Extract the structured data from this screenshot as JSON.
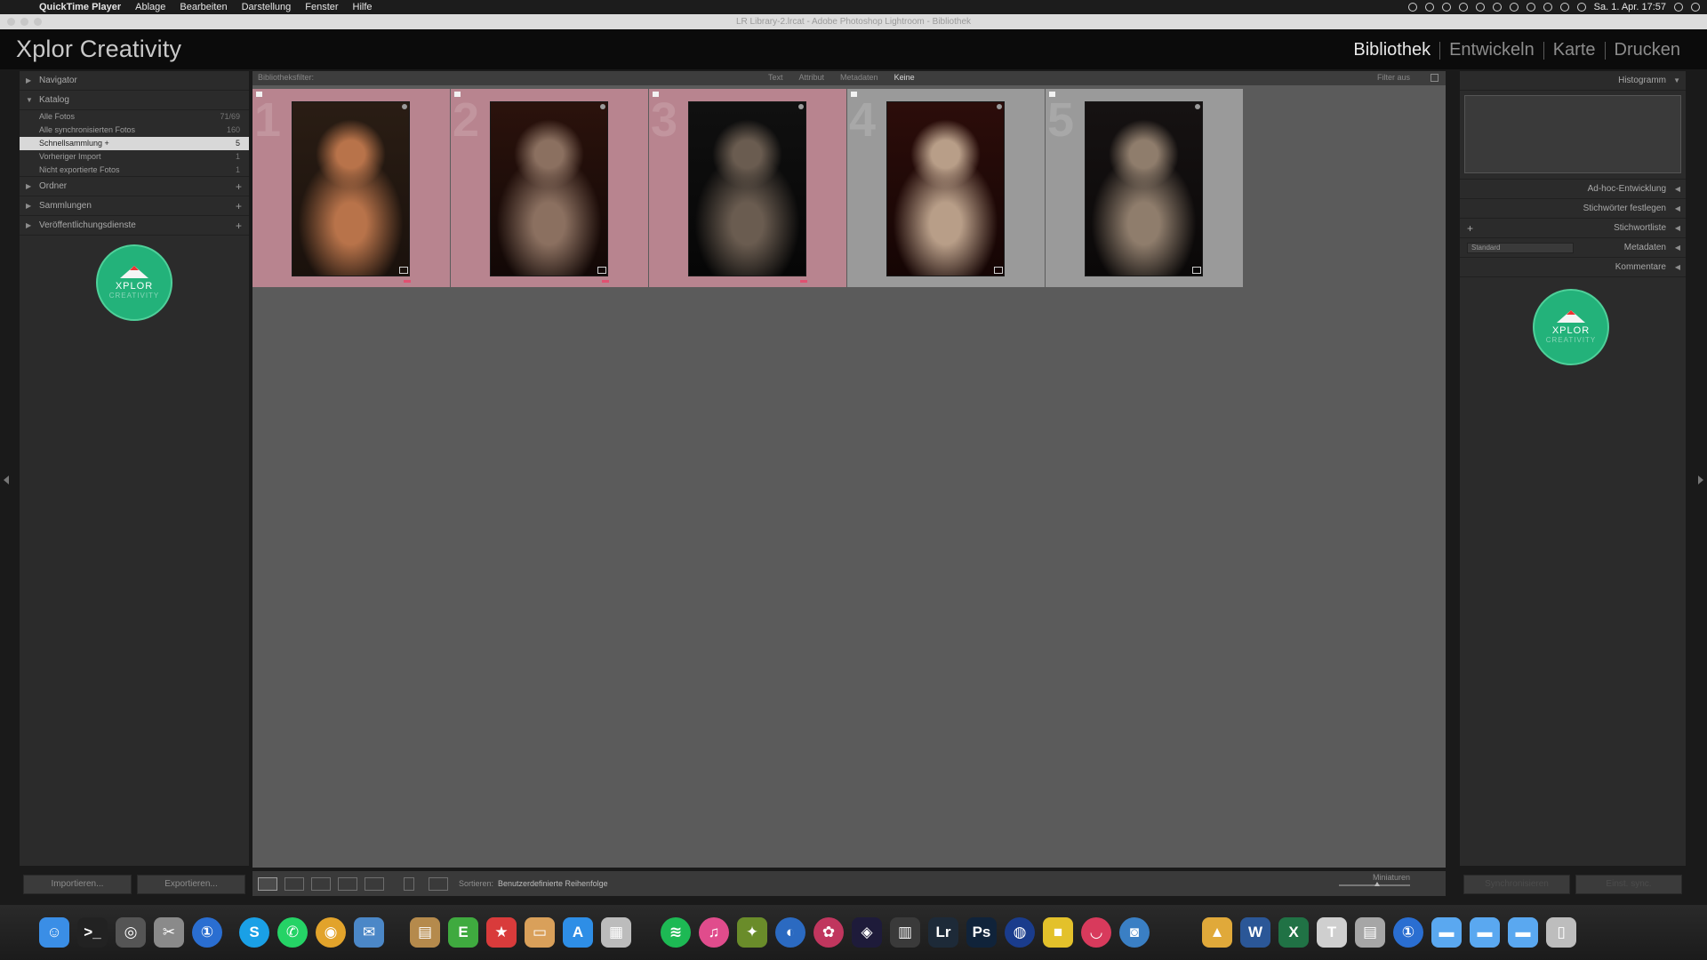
{
  "menubar": {
    "app": "QuickTime Player",
    "items": [
      "Ablage",
      "Bearbeiten",
      "Darstellung",
      "Fenster",
      "Hilfe"
    ],
    "clock": "Sa. 1. Apr. 17:57"
  },
  "window": {
    "title": "LR Library-2.lrcat - Adobe Photoshop Lightroom - Bibliothek"
  },
  "identity": {
    "brand": "Xplor Creativity"
  },
  "modules": [
    {
      "label": "Bibliothek",
      "active": true
    },
    {
      "label": "Entwickeln",
      "active": false
    },
    {
      "label": "Karte",
      "active": false
    },
    {
      "label": "Drucken",
      "active": false
    }
  ],
  "left_panel": {
    "navigator": "Navigator",
    "catalog": "Katalog",
    "catalog_items": [
      {
        "label": "Alle Fotos",
        "count": "71/69"
      },
      {
        "label": "Alle synchronisierten Fotos",
        "count": "160"
      },
      {
        "label": "Schnellsammlung +",
        "count": "5",
        "selected": true
      },
      {
        "label": "Vorheriger Import",
        "count": "1"
      },
      {
        "label": "Nicht exportierte Fotos",
        "count": "1"
      }
    ],
    "folders": "Ordner",
    "collections": "Sammlungen",
    "publish": "Veröffentlichungsdienste",
    "import_btn": "Importieren...",
    "export_btn": "Exportieren..."
  },
  "logo": {
    "line1": "XPLOR",
    "line2": "CREATIVITY"
  },
  "filterbar": {
    "label": "Bibliotheksfilter:",
    "tabs": [
      "Text",
      "Attribut",
      "Metadaten",
      "Keine"
    ],
    "active_tab": "Keine",
    "preset": "Filter aus"
  },
  "grid": {
    "cells": [
      {
        "num": "1",
        "picked": true,
        "palette": [
          "#2a1d14",
          "#b8734a",
          "#1a110c"
        ]
      },
      {
        "num": "2",
        "picked": true,
        "palette": [
          "#2b120c",
          "#8b7060",
          "#120806"
        ]
      },
      {
        "num": "3",
        "picked": true,
        "palette": [
          "#101010",
          "#6a5c50",
          "#060606"
        ]
      },
      {
        "num": "4",
        "picked": false,
        "palette": [
          "#2c0d0a",
          "#b89e88",
          "#150504"
        ]
      },
      {
        "num": "5",
        "picked": false,
        "palette": [
          "#161212",
          "#8f7d6c",
          "#0a0808"
        ]
      }
    ]
  },
  "toolbar": {
    "sort_label": "Sortieren:",
    "sort_value": "Benutzerdefinierte Reihenfolge",
    "thumbs_label": "Miniaturen"
  },
  "right_panel": {
    "histogram": "Histogramm",
    "quick_develop": "Ad-hoc-Entwicklung",
    "keywording": "Stichwörter festlegen",
    "keyword_list": "Stichwortliste",
    "metadata_preset": "Standard",
    "metadata": "Metadaten",
    "comments": "Kommentare",
    "sync_btn": "Synchronisieren",
    "sync_settings_btn": "Einst. sync."
  },
  "colors": {
    "picked_cell": "#b8848f",
    "unpicked_cell": "#9a9a9a",
    "brand_green": "#23b27a"
  },
  "dock": [
    {
      "name": "finder-icon",
      "color": "#3a8ee6",
      "glyph": "☺"
    },
    {
      "name": "terminal-icon",
      "color": "#222222",
      "glyph": ">_"
    },
    {
      "name": "launchpad-icon",
      "color": "#555555",
      "glyph": "◎"
    },
    {
      "name": "tools-icon",
      "color": "#8a8a8a",
      "glyph": "✂"
    },
    {
      "name": "onepassword-icon",
      "color": "#2a6ed1",
      "glyph": "①"
    },
    {
      "name": "skype-icon",
      "color": "#1aa0e6",
      "glyph": "S"
    },
    {
      "name": "whatsapp-icon",
      "color": "#25d366",
      "glyph": "✆"
    },
    {
      "name": "chrome-icon",
      "color": "#e2a32b",
      "glyph": "◉"
    },
    {
      "name": "mail-icon",
      "color": "#4b87c7",
      "glyph": "✉"
    },
    {
      "name": "notes-icon",
      "color": "#b58a4c",
      "glyph": "▤"
    },
    {
      "name": "evernote-icon",
      "color": "#3faa3f",
      "glyph": "E"
    },
    {
      "name": "bookmark-icon",
      "color": "#d93b3b",
      "glyph": "★"
    },
    {
      "name": "wallet-icon",
      "color": "#d9a05a",
      "glyph": "▭"
    },
    {
      "name": "appstore-icon",
      "color": "#2e8ee6",
      "glyph": "A"
    },
    {
      "name": "preview-icon",
      "color": "#bcbcbc",
      "glyph": "▦"
    },
    {
      "name": "spotify-icon",
      "color": "#1db954",
      "glyph": "≋"
    },
    {
      "name": "itunes-icon",
      "color": "#e04c8c",
      "glyph": "♫"
    },
    {
      "name": "cocktail-icon",
      "color": "#6a8c2a",
      "glyph": "✦"
    },
    {
      "name": "browser-icon",
      "color": "#2b6ac1",
      "glyph": "◐"
    },
    {
      "name": "resolve-icon",
      "color": "#c0365e",
      "glyph": "✿"
    },
    {
      "name": "premiere-icon",
      "color": "#1e1b3a",
      "glyph": "◈"
    },
    {
      "name": "lightroom-classic-icon",
      "color": "#3a3a3a",
      "glyph": "▥"
    },
    {
      "name": "lightroom-icon",
      "color": "#1d2a38",
      "glyph": "Lr"
    },
    {
      "name": "photoshop-icon",
      "color": "#10233a",
      "glyph": "Ps"
    },
    {
      "name": "globe-icon",
      "color": "#1a3c8c",
      "glyph": "◍"
    },
    {
      "name": "color-app-icon",
      "color": "#e3c12b",
      "glyph": "■"
    },
    {
      "name": "lips-icon",
      "color": "#d83a5c",
      "glyph": "◡"
    },
    {
      "name": "screenshot-icon",
      "color": "#3a7fc4",
      "glyph": "◙"
    },
    {
      "name": "maps-icon",
      "color": "#e0a93a",
      "glyph": "▲"
    },
    {
      "name": "word-icon",
      "color": "#2b5797",
      "glyph": "W"
    },
    {
      "name": "excel-icon",
      "color": "#207245",
      "glyph": "X"
    },
    {
      "name": "keynote-icon",
      "color": "#cfcfcf",
      "glyph": "T"
    },
    {
      "name": "files-icon",
      "color": "#a6a6a6",
      "glyph": "▤"
    },
    {
      "name": "onepassword-icon-2",
      "color": "#2a6ed1",
      "glyph": "①"
    },
    {
      "name": "folder-icon",
      "color": "#5aa8f0",
      "glyph": "▬"
    },
    {
      "name": "folder-icon-2",
      "color": "#5aa8f0",
      "glyph": "▬"
    },
    {
      "name": "folder-icon-3",
      "color": "#5aa8f0",
      "glyph": "▬"
    },
    {
      "name": "trash-icon",
      "color": "#bdbdbd",
      "glyph": "▯"
    }
  ]
}
